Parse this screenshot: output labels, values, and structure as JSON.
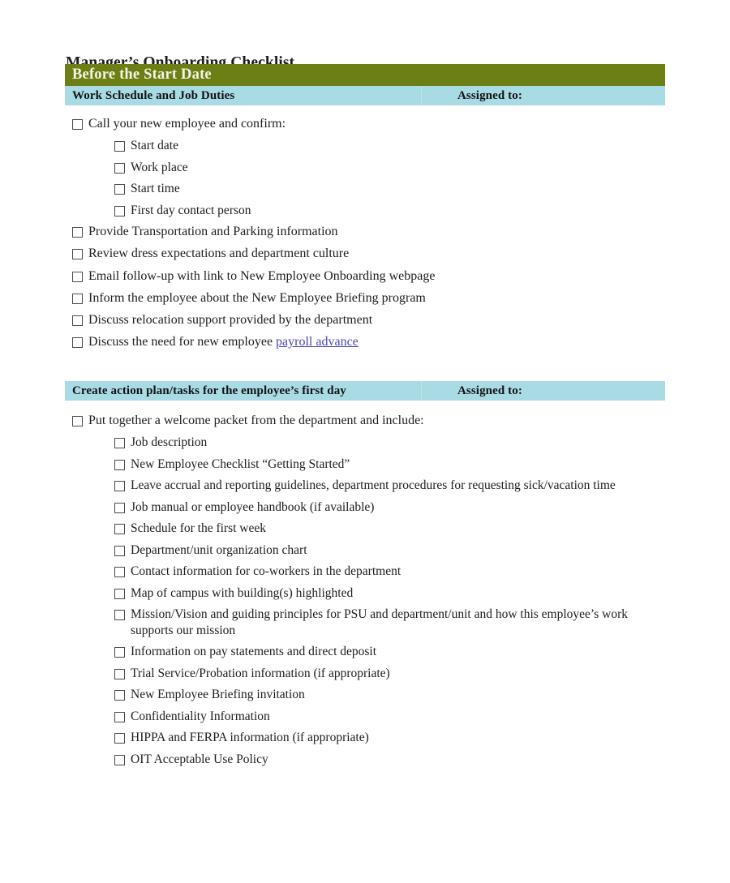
{
  "document": {
    "title": "Manager’s Onboarding Checklist",
    "colors": {
      "section_bar": "#6b7f15",
      "subsection_bar": "#a9dbe5",
      "link": "#4a46ad",
      "checkbox_border": "#4a4a4a",
      "page_background": "#ffffff"
    }
  },
  "section_bar": {
    "label": "Before the Start Date"
  },
  "sections": [
    {
      "id": "work-schedule-and-job-duties",
      "heading": "Work Schedule and Job Duties",
      "assigned_to_label": "Assigned to:",
      "items": [
        {
          "level": 0,
          "text": "Call your new employee and confirm:"
        },
        {
          "level": 1,
          "text": "Start date"
        },
        {
          "level": 1,
          "text": "Work place"
        },
        {
          "level": 1,
          "text": "Start time"
        },
        {
          "level": 1,
          "text": "First day contact person"
        },
        {
          "level": 0,
          "text": "Provide Transportation and Parking information"
        },
        {
          "level": 0,
          "text": "Review dress expectations and department culture"
        },
        {
          "level": 0,
          "text": "Email follow-up with link to New Employee Onboarding webpage"
        },
        {
          "level": 0,
          "text": "Inform the employee about the New Employee Briefing program"
        },
        {
          "level": 0,
          "text": "Discuss relocation support provided by the department"
        },
        {
          "level": 0,
          "text": "Discuss the need for new employee ",
          "link_text": "payroll advance"
        }
      ]
    },
    {
      "id": "create-action-plan",
      "heading": "Create action plan/tasks for the employee’s first day",
      "assigned_to_label": "Assigned to:",
      "items": [
        {
          "level": 0,
          "text": "Put together a welcome packet from the department and include:"
        },
        {
          "level": 1,
          "text": "Job description"
        },
        {
          "level": 1,
          "text": "New Employee Checklist “Getting Started”"
        },
        {
          "level": 1,
          "text": "Leave accrual and reporting guidelines, department procedures for requesting sick/vacation time"
        },
        {
          "level": 1,
          "text": "Job manual or employee handbook (if available)"
        },
        {
          "level": 1,
          "text": "Schedule for the first week"
        },
        {
          "level": 1,
          "text": "Department/unit organization chart"
        },
        {
          "level": 1,
          "text": "Contact information for co-workers in the department"
        },
        {
          "level": 1,
          "text": "Map of campus with building(s) highlighted"
        },
        {
          "level": 1,
          "text": "Mission/Vision and guiding principles for PSU and department/unit and how this employee’s work supports our mission"
        },
        {
          "level": 1,
          "text": "Information on pay statements and direct deposit"
        },
        {
          "level": 1,
          "text": "Trial Service/Probation information  (if appropriate)"
        },
        {
          "level": 1,
          "text": "New Employee Briefing invitation"
        },
        {
          "level": 1,
          "text": "Confidentiality Information"
        },
        {
          "level": 1,
          "text": "HIPPA and FERPA information (if appropriate)"
        },
        {
          "level": 1,
          "text": "OIT Acceptable Use Policy"
        }
      ]
    }
  ]
}
